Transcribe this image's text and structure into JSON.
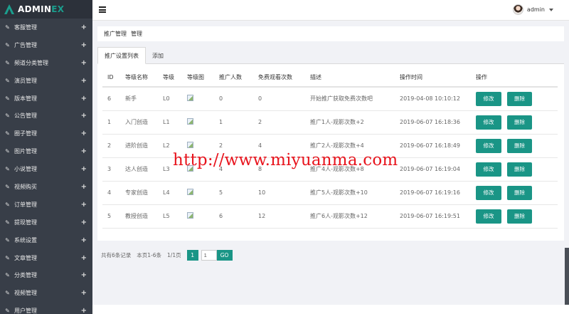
{
  "brand": {
    "name_main": "ADMIN",
    "name_accent": "EX"
  },
  "sidebar": {
    "items": [
      {
        "label": "客服管理",
        "icon": "edit-icon"
      },
      {
        "label": "广告管理",
        "icon": "edit-icon"
      },
      {
        "label": "频道分类管理",
        "icon": "edit-icon"
      },
      {
        "label": "演员管理",
        "icon": "edit-icon"
      },
      {
        "label": "版本管理",
        "icon": "edit-icon"
      },
      {
        "label": "公告管理",
        "icon": "edit-icon"
      },
      {
        "label": "圈子管理",
        "icon": "edit-icon"
      },
      {
        "label": "图片管理",
        "icon": "edit-icon"
      },
      {
        "label": "小说管理",
        "icon": "edit-icon"
      },
      {
        "label": "视频购买",
        "icon": "edit-icon"
      },
      {
        "label": "订单管理",
        "icon": "edit-icon"
      },
      {
        "label": "提现管理",
        "icon": "edit-icon"
      },
      {
        "label": "系统设置",
        "icon": "edit-icon"
      },
      {
        "label": "文章管理",
        "icon": "edit-icon"
      },
      {
        "label": "分类管理",
        "icon": "edit-icon"
      },
      {
        "label": "视频管理",
        "icon": "edit-icon"
      },
      {
        "label": "用户管理",
        "icon": "edit-icon"
      }
    ],
    "expand_symbol": "+"
  },
  "header": {
    "user_name": "admin"
  },
  "breadcrumb": {
    "section": "推广管理",
    "page": "管理"
  },
  "tabs": [
    {
      "label": "推广设置列表",
      "active": true
    },
    {
      "label": "添加",
      "active": false
    }
  ],
  "table": {
    "headers": [
      "ID",
      "等级名称",
      "等级",
      "等级图",
      "推广人数",
      "免费观看次数",
      "描述",
      "操作时间",
      "操作"
    ],
    "rows": [
      {
        "id": "6",
        "name": "新手",
        "level": "L0",
        "count": "0",
        "free": "0",
        "desc": "开始推广获取免费次数吧",
        "time": "2019-04-08 10:10:12"
      },
      {
        "id": "1",
        "name": "入门创造",
        "level": "L1",
        "count": "1",
        "free": "2",
        "desc": "推广1人-观影次数+2",
        "time": "2019-06-07 16:18:36"
      },
      {
        "id": "2",
        "name": "进阶创造",
        "level": "L2",
        "count": "2",
        "free": "4",
        "desc": "推广2人-观影次数+4",
        "time": "2019-06-07 16:18:49"
      },
      {
        "id": "3",
        "name": "达人创造",
        "level": "L3",
        "count": "4",
        "free": "8",
        "desc": "推广4人-观影次数+8",
        "time": "2019-06-07 16:19:04"
      },
      {
        "id": "4",
        "name": "专家创造",
        "level": "L4",
        "count": "5",
        "free": "10",
        "desc": "推广5人-观影次数+10",
        "time": "2019-06-07 16:19:16"
      },
      {
        "id": "5",
        "name": "教授创造",
        "level": "L5",
        "count": "6",
        "free": "12",
        "desc": "推广6人-观影次数+12",
        "time": "2019-06-07 16:19:51"
      }
    ],
    "edit_label": "修改",
    "delete_label": "删除"
  },
  "pagination": {
    "total_text": "共有6条记录",
    "range_text": "本页1-6条",
    "page_text": "1/1页",
    "current_page": "1",
    "input_value": "1",
    "go_label": "GO"
  },
  "watermark": "http://www.miyuanma.com",
  "colors": {
    "accent": "#1a9586",
    "sidebar_bg": "#383e48",
    "watermark": "#e8141d"
  }
}
